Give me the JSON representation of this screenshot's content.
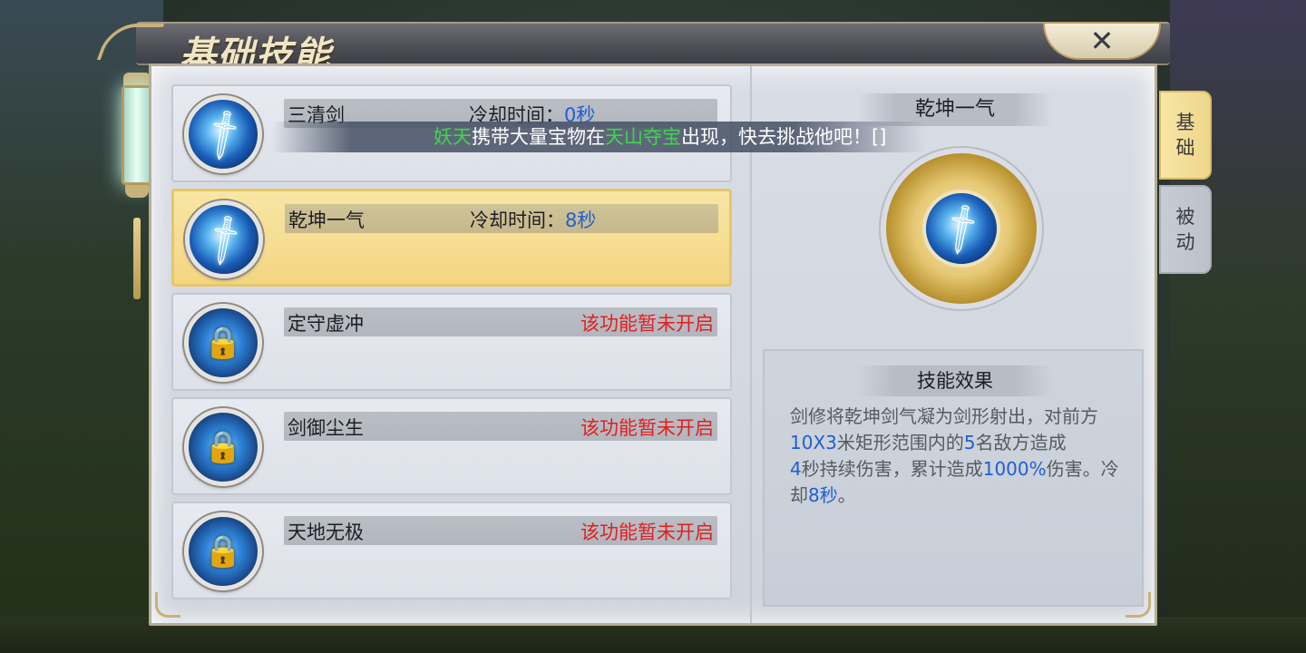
{
  "window": {
    "title": "基础技能",
    "close_label": "✕"
  },
  "skills": [
    {
      "name": "三清剑",
      "cd_label": "冷却时间：",
      "cd_value": "0秒",
      "selected": false,
      "locked": false
    },
    {
      "name": "乾坤一气",
      "cd_label": "冷却时间：",
      "cd_value": "8秒",
      "selected": true,
      "locked": false
    },
    {
      "name": "定守虚冲",
      "status": "该功能暂未开启",
      "selected": false,
      "locked": true
    },
    {
      "name": "剑御尘生",
      "status": "该功能暂未开启",
      "selected": false,
      "locked": true
    },
    {
      "name": "天地无极",
      "status": "该功能暂未开启",
      "selected": false,
      "locked": true
    }
  ],
  "notice": {
    "part1": "妖天",
    "part2": "携带大量宝物在",
    "part3": "天山夺宝",
    "part4": "出现，快去挑战他吧！[]"
  },
  "detail": {
    "skill_name": "乾坤一气",
    "effect_title": "技能效果",
    "effect_segments": [
      {
        "text": "剑修将乾坤剑气凝为剑形射出，对前方",
        "hl": false
      },
      {
        "text": "10X3",
        "hl": true
      },
      {
        "text": "米矩形范围内的",
        "hl": false
      },
      {
        "text": "5",
        "hl": true
      },
      {
        "text": "名敌方造成",
        "hl": false
      },
      {
        "text": "4",
        "hl": true
      },
      {
        "text": "秒持续伤害，累计造成",
        "hl": false
      },
      {
        "text": "1000%",
        "hl": true
      },
      {
        "text": "伤害。冷却",
        "hl": false
      },
      {
        "text": "8秒",
        "hl": true
      },
      {
        "text": "。",
        "hl": false
      }
    ]
  },
  "tabs": [
    {
      "label_top": "基",
      "label_bottom": "础",
      "active": true
    },
    {
      "label_top": "被",
      "label_bottom": "动",
      "active": false
    }
  ],
  "icons": {
    "skill_icon": "sword-icon",
    "locked_icon": "lock-chain-icon",
    "close_icon": "close-icon"
  },
  "colors": {
    "highlight_blue": "#1f5fd0",
    "locked_red": "#e02020",
    "notice_green": "#3bd84a",
    "selected_gold": "#f4d682"
  }
}
